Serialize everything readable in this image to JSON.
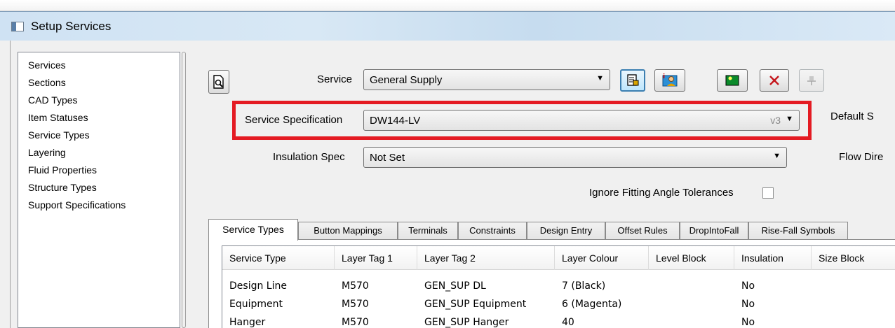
{
  "window": {
    "title": "Setup Services"
  },
  "sidebar": {
    "items": [
      {
        "label": "Services"
      },
      {
        "label": "Sections"
      },
      {
        "label": "CAD Types"
      },
      {
        "label": "Item Statuses"
      },
      {
        "label": "Service Types"
      },
      {
        "label": "Layering"
      },
      {
        "label": "Fluid Properties"
      },
      {
        "label": "Structure Types"
      },
      {
        "label": "Support Specifications"
      }
    ]
  },
  "form": {
    "service_label": "Service",
    "service_value": "General Supply",
    "spec_label": "Service Specification",
    "spec_value": "DW144-LV",
    "spec_version": "v3",
    "insulation_label": "Insulation Spec",
    "insulation_value": "Not Set",
    "ignore_tolerances_label": "Ignore Fitting Angle Tolerances",
    "ignore_tolerances_checked": false,
    "default_label": "Default S",
    "flow_label": "Flow Dire"
  },
  "toolbar": {
    "icons": [
      "preview-icon",
      "properties-icon",
      "user-edit-icon",
      "add-service-icon",
      "delete-icon",
      "pin-icon"
    ]
  },
  "tabs": [
    {
      "label": "Service Types",
      "selected": true
    },
    {
      "label": "Button Mappings"
    },
    {
      "label": "Terminals"
    },
    {
      "label": "Constraints"
    },
    {
      "label": "Design Entry"
    },
    {
      "label": "Offset Rules"
    },
    {
      "label": "DropIntoFall"
    },
    {
      "label": "Rise-Fall Symbols"
    }
  ],
  "grid": {
    "columns": [
      "Service Type",
      "Layer Tag 1",
      "Layer Tag 2",
      "Layer Colour",
      "Level Block",
      "Insulation",
      "Size Block"
    ],
    "rows": [
      [
        "Design Line",
        "M570",
        "GEN_SUP DL",
        "7 (Black)",
        "",
        "No",
        ""
      ],
      [
        "Equipment",
        "M570",
        "GEN_SUP Equipment",
        "6 (Magenta)",
        "",
        "No",
        ""
      ],
      [
        "Hanger",
        "M570",
        "GEN_SUP Hanger",
        "40",
        "",
        "No",
        ""
      ]
    ]
  },
  "colors": {
    "highlight": "#e41b23",
    "selection_border": "#3c7fb1"
  }
}
